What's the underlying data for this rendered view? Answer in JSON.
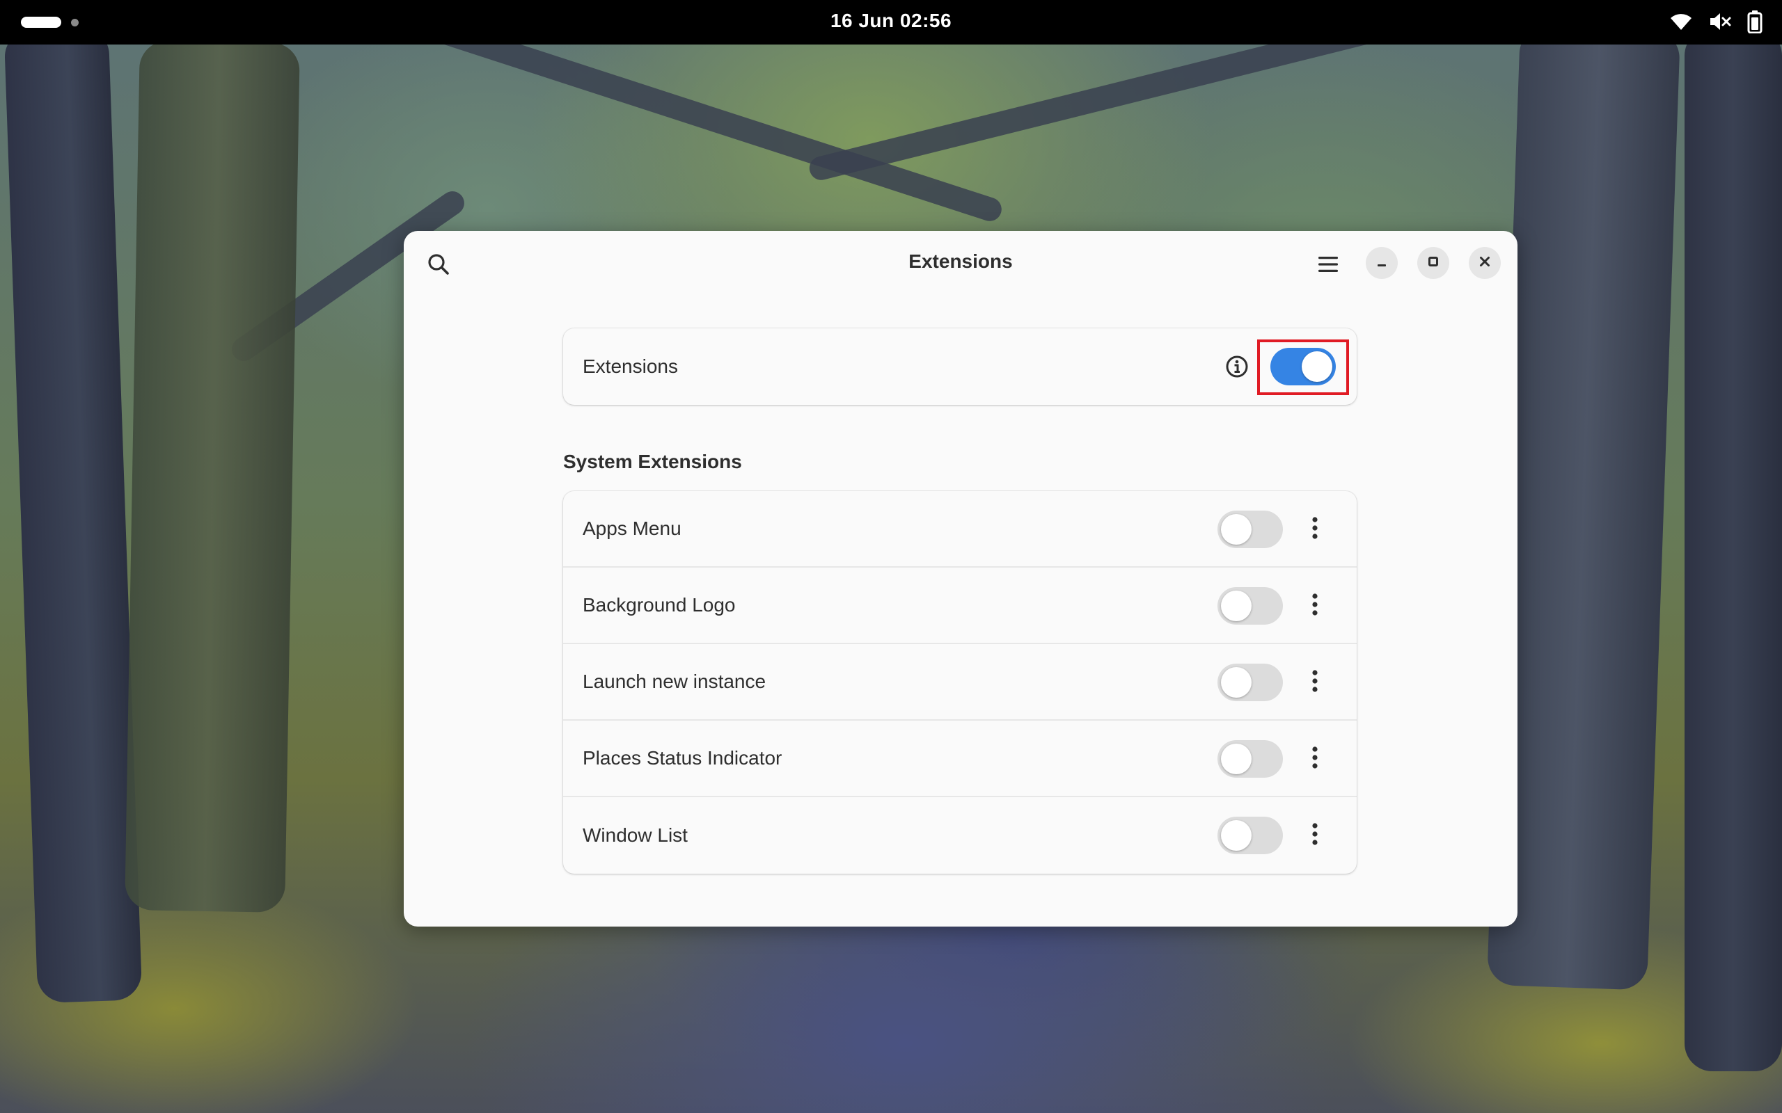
{
  "topbar": {
    "clock": "16 Jun  02:56",
    "icons": [
      "wifi-icon",
      "volume-muted-icon",
      "battery-icon"
    ]
  },
  "window": {
    "title": "Extensions",
    "header_icons": [
      "search-icon",
      "hamburger-menu-icon",
      "minimize-icon",
      "maximize-icon",
      "close-icon"
    ]
  },
  "main_toggle": {
    "label": "Extensions",
    "enabled": true,
    "info_icon": "info-icon"
  },
  "system_extensions": {
    "heading": "System Extensions",
    "items": [
      {
        "label": "Apps Menu",
        "enabled": false
      },
      {
        "label": "Background Logo",
        "enabled": false
      },
      {
        "label": "Launch new instance",
        "enabled": false
      },
      {
        "label": "Places Status Indicator",
        "enabled": false
      },
      {
        "label": "Window List",
        "enabled": false
      }
    ]
  },
  "colors": {
    "accent": "#3584e4",
    "highlight": "#e01b24",
    "topbar": "#000000",
    "window_bg": "#fafafa"
  }
}
